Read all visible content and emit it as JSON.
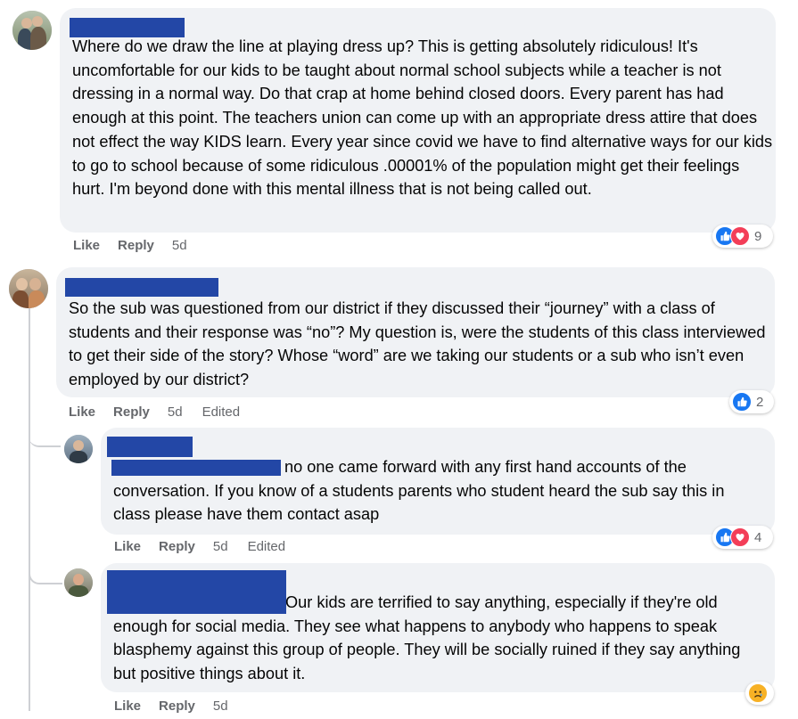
{
  "labels": {
    "like": "Like",
    "reply": "Reply"
  },
  "comments": [
    {
      "text": "Where do we draw the line at playing dress up? This is getting absolutely ridiculous! It's uncomfortable for our kids to be taught about normal school subjects while a teacher is not dressing in a normal way. Do that crap at home behind closed doors. Every parent has had enough at this point. The teachers union can come up with an appropriate dress attire that does not effect the way KIDS learn. Every year since covid we have to find alternative ways for our kids to go to school because of some ridiculous .00001% of the population might get their feelings hurt. I'm beyond done with this mental illness that is not being called out.",
      "time": "5d",
      "edited": "",
      "reactions": [
        "like",
        "love"
      ],
      "reaction_count": "9"
    },
    {
      "text": "So the sub was questioned from our district if they discussed their “journey” with a class of students and their response was “no”? My question is, were the students of this class interviewed to get their side of the story? Whose “word” are we taking our students or a sub who isn’t even employed by our district?",
      "time": "5d",
      "edited": "Edited",
      "reactions": [
        "like"
      ],
      "reaction_count": "2"
    },
    {
      "text": "no one came forward with any first hand accounts of the conversation. If you know of a students parents who student heard the sub say this in class please have them contact asap",
      "time": "5d",
      "edited": "Edited",
      "reactions": [
        "like",
        "love"
      ],
      "reaction_count": "4"
    },
    {
      "text": "Our kids are terrified to say anything, especially if they're old enough for social media. They see what happens to anybody who happens to speak blasphemy against this group of people. They will be socially ruined if they say anything but positive things about it.",
      "time": "5d",
      "edited": "",
      "reactions": [
        "sad"
      ],
      "reaction_count": ""
    }
  ],
  "colors": {
    "bubble": "#f0f2f5",
    "redaction": "#2347a6",
    "like": "#1877f2",
    "love": "#f33e58",
    "sad": "#f7b125",
    "muted_text": "#65676b"
  }
}
